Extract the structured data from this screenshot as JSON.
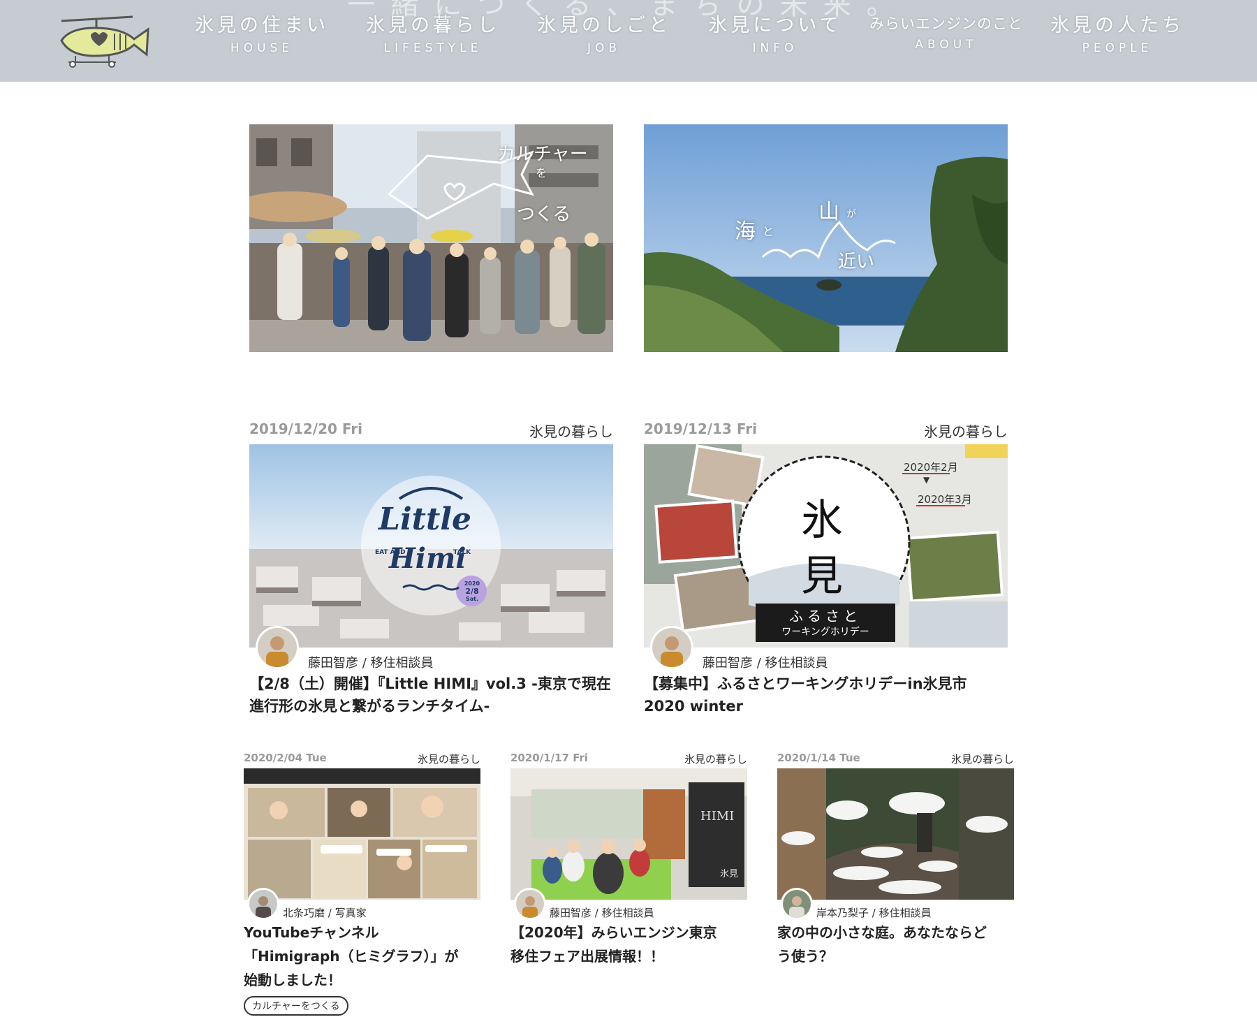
{
  "header": {
    "tagline": "一緒につくる、まちの未来。",
    "logo_alt": "HIMI MIRAI ENGINE",
    "nav": [
      {
        "ja": "氷見の住まい",
        "en": "HOUSE"
      },
      {
        "ja": "氷見の暮らし",
        "en": "LIFESTYLE"
      },
      {
        "ja": "氷見のしごと",
        "en": "JOB"
      },
      {
        "ja": "氷見について",
        "en": "INFO"
      },
      {
        "ja": "みらいエンジンのこと",
        "en": "ABOUT"
      },
      {
        "ja": "氷見の人たち",
        "en": "PEOPLE"
      }
    ]
  },
  "banners": [
    {
      "line1": "カルチャー",
      "line2": "を",
      "line3": "つくる"
    },
    {
      "line1": "海",
      "line2": "と",
      "line3": "山",
      "line4": "が",
      "line5": "近い"
    }
  ],
  "featured": [
    {
      "date": "2019/12/20 Fri",
      "category": "氷見の暮らし",
      "thumb_text": {
        "main1": "Little",
        "main2": "Himi",
        "sub_left": "EAT AND",
        "sub_right": "TALK",
        "badge1": "2020",
        "badge2": "2/8",
        "badge3": "Sat."
      },
      "author": "藤田智彦 / 移住相談員",
      "title_line1": "【2/8（土）開催】『Little HIMI』vol.3 -東京で現在",
      "title_line2": "進行形の氷見と繋がるランチタイム-"
    },
    {
      "date": "2019/12/13 Fri",
      "category": "氷見の暮らし",
      "thumb_text": {
        "kanji1": "氷",
        "kanji2": "見",
        "band1": "ふるさと",
        "band2": "ワーキングホリデー",
        "from": "2020年2月",
        "arrow": "▼",
        "to": "2020年3月"
      },
      "author": "藤田智彦 / 移住相談員",
      "title_line1": "【募集中】ふるさとワーキングホリデーin氷見市",
      "title_line2": "2020 winter"
    }
  ],
  "articles": [
    {
      "date": "2020/2/04 Tue",
      "category": "氷見の暮らし",
      "author": "北条巧磨 / 写真家",
      "title_line1": "YouTubeチャンネル",
      "title_line2": "「Himigraph（ヒミグラフ）」が",
      "title_line3": "始動しました！",
      "tag": "カルチャーをつくる"
    },
    {
      "date": "2020/1/17 Fri",
      "category": "氷見の暮らし",
      "author": "藤田智彦 / 移住相談員",
      "title_line1": "【2020年】みらいエンジン東京",
      "title_line2": "移住フェア出展情報！！",
      "title_line3": "",
      "thumb_text": {
        "poster": "HIMI",
        "poster_sub": "氷見"
      }
    },
    {
      "date": "2020/1/14 Tue",
      "category": "氷見の暮らし",
      "author": "岸本乃梨子 / 移住相談員",
      "title_line1": "家の中の小さな庭。あなたならど",
      "title_line2": "う使う？",
      "title_line3": ""
    }
  ],
  "colors": {
    "header_bg": "#c6ccd1",
    "date": "#9a9a9a",
    "text": "#222222"
  }
}
